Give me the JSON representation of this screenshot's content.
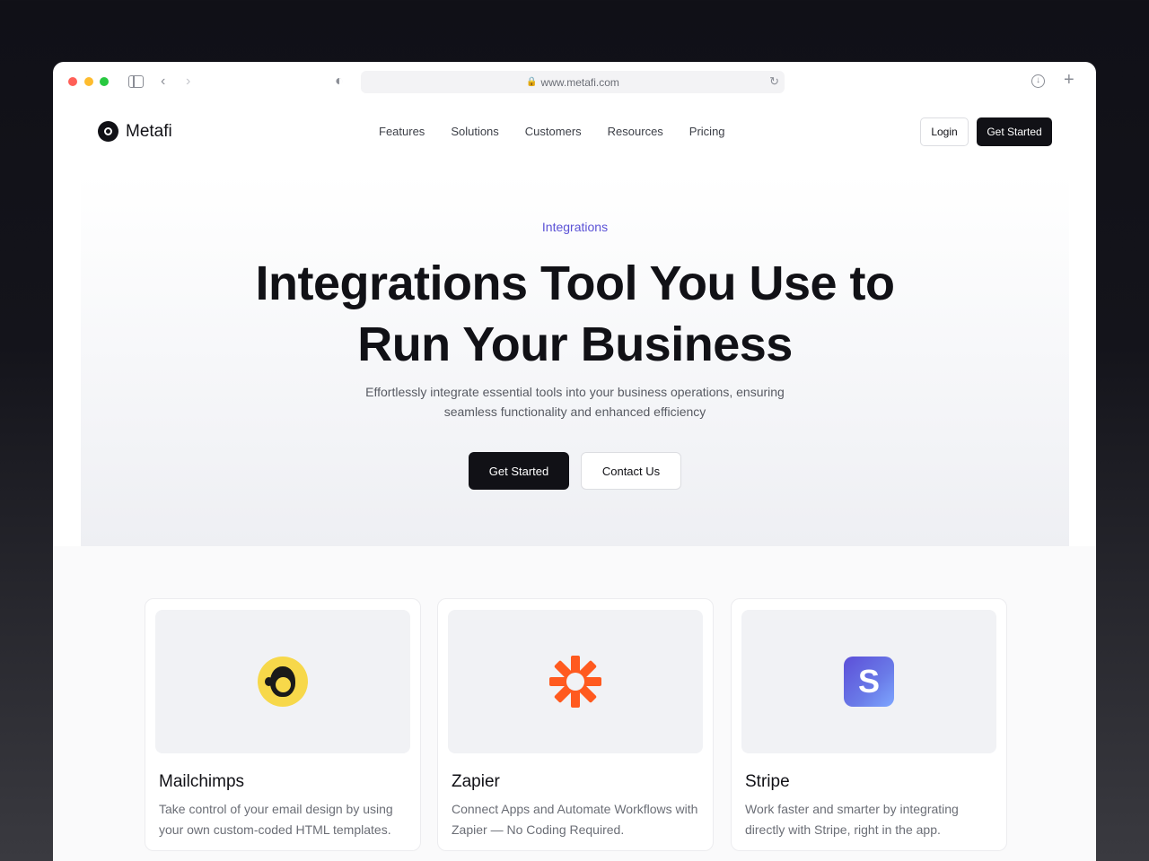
{
  "browser": {
    "url": "www.metafi.com",
    "icons": [
      "sidebar-icon",
      "back-icon",
      "forward-icon",
      "shield-icon",
      "lock-icon",
      "reload-icon",
      "download-icon",
      "plus-icon"
    ]
  },
  "nav": {
    "brand": "Metafi",
    "links": [
      "Features",
      "Solutions",
      "Customers",
      "Resources",
      "Pricing"
    ],
    "login": "Login",
    "get_started": "Get Started"
  },
  "hero": {
    "eyebrow": "Integrations",
    "title_line1": "Integrations Tool You Use to",
    "title_line2": "Run Your Business",
    "subtitle_line1": "Effortlessly integrate essential tools into your business operations, ensuring",
    "subtitle_line2": "seamless functionality and enhanced efficiency",
    "primary_button": "Get Started",
    "secondary_button": "Contact Us"
  },
  "cards": [
    {
      "title": "Mailchimps",
      "description": "Take control of your email design by using your own custom-coded HTML templates.",
      "icon": "mailchimp-icon"
    },
    {
      "title": "Zapier",
      "description": "Connect Apps and Automate Workflows with Zapier — No Coding Required.",
      "icon": "zapier-icon"
    },
    {
      "title": "Stripe",
      "description": "Work faster and smarter by integrating directly with Stripe, right in the app.",
      "icon": "stripe-icon",
      "icon_letter": "S"
    }
  ],
  "colors": {
    "accent": "#5b52d6",
    "dark": "#111116",
    "zapier": "#ff5a1f",
    "mailchimp": "#f7d84a"
  }
}
